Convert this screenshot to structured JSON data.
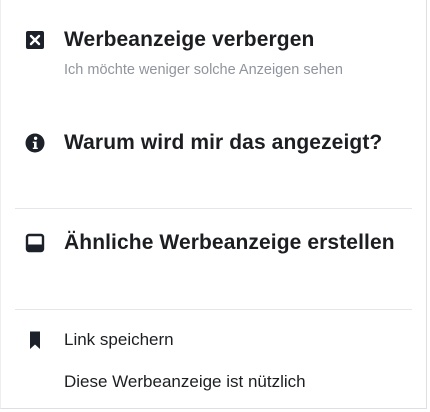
{
  "menu": {
    "hide_ad": {
      "icon": "close-box-icon",
      "title": "Werbeanzeige verbergen",
      "subtitle": "Ich möchte weniger solche Anzeigen sehen"
    },
    "why_shown": {
      "icon": "info-icon",
      "title": "Warum wird mir das angezeigt?"
    },
    "create_similar": {
      "icon": "ad-preview-icon",
      "title": "Ähnliche Werbeanzeige erstellen"
    },
    "save_link": {
      "icon": "bookmark-icon",
      "label": "Link speichern"
    },
    "useful": {
      "label": "Diese Werbeanzeige ist nützlich"
    }
  }
}
